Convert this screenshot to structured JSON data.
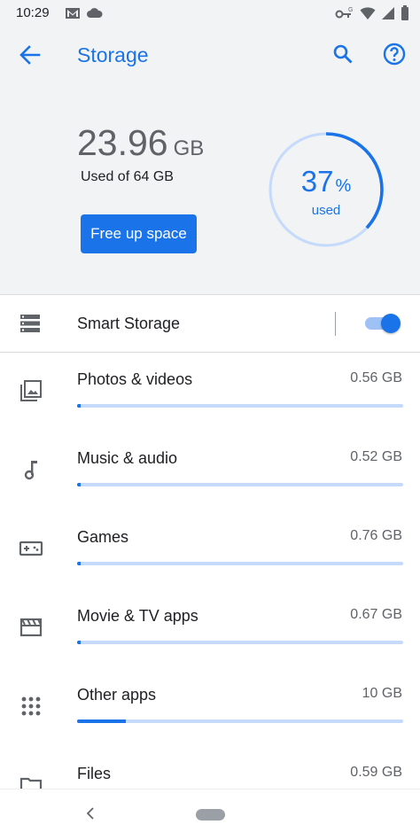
{
  "status_bar": {
    "time": "10:29",
    "left_icons": [
      "gmail-icon",
      "cloud-icon"
    ],
    "right_icons": [
      "vpn-key-icon",
      "wifi-icon",
      "signal-icon",
      "battery-icon"
    ]
  },
  "header": {
    "title": "Storage",
    "back_icon": "arrow-back-icon",
    "actions": [
      "search-icon",
      "help-icon"
    ]
  },
  "summary": {
    "used_value": "23.96",
    "used_unit": "GB",
    "used_of": "Used of 64 GB",
    "free_button": "Free up space",
    "percent_value": "37",
    "percent_sign": "%",
    "percent_caption": "used",
    "percent_fraction": 0.37
  },
  "smart_storage": {
    "label": "Smart Storage",
    "enabled": true
  },
  "categories": [
    {
      "icon": "photo-library-icon",
      "label": "Photos & videos",
      "size": "0.56 GB",
      "fraction": 0.005
    },
    {
      "icon": "music-note-icon",
      "label": "Music & audio",
      "size": "0.52 GB",
      "fraction": 0.005
    },
    {
      "icon": "gamepad-icon",
      "label": "Games",
      "size": "0.76 GB",
      "fraction": 0.01
    },
    {
      "icon": "movie-icon",
      "label": "Movie & TV apps",
      "size": "0.67 GB",
      "fraction": 0.01
    },
    {
      "icon": "apps-grid-icon",
      "label": "Other apps",
      "size": "10 GB",
      "fraction": 0.15
    },
    {
      "icon": "folder-icon",
      "label": "Files",
      "size": "0.59 GB",
      "fraction": 0.01
    }
  ],
  "colors": {
    "accent": "#1a73e8",
    "bar_track": "#c6dafc",
    "header_bg": "#f1f3f4"
  }
}
